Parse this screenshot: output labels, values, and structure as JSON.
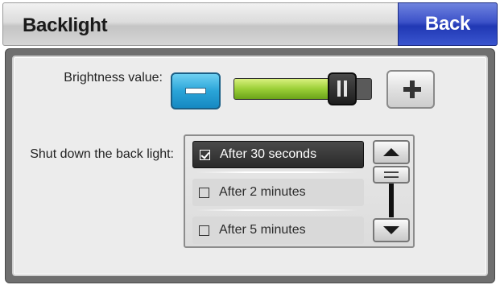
{
  "header": {
    "title": "Backlight",
    "back_label": "Back"
  },
  "brightness": {
    "label": "Brightness value:",
    "level": 0.86,
    "minus_icon": "minus-icon",
    "plus_icon": "plus-icon"
  },
  "shutdown": {
    "label": "Shut down the back light:",
    "options": [
      {
        "label": "After 30 seconds",
        "checked": true,
        "selected": true
      },
      {
        "label": "After 2 minutes",
        "checked": false,
        "selected": false
      },
      {
        "label": "After 5 minutes",
        "checked": false,
        "selected": false
      }
    ]
  },
  "colors": {
    "back_button": "#3c52c8",
    "slider_fill": "#9bcf37",
    "minus_button": "#2aa4d8"
  }
}
